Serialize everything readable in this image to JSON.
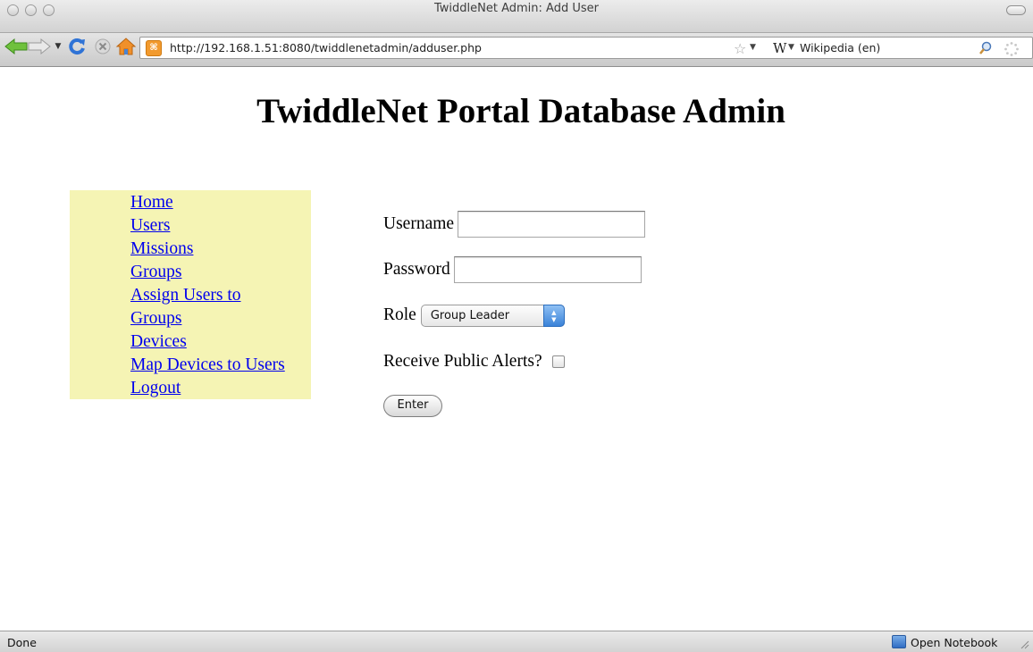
{
  "window": {
    "title": "TwiddleNet Admin: Add User"
  },
  "toolbar": {
    "url": "http://192.168.1.51:8080/twiddlenetadmin/adduser.php",
    "search_engine": "Wikipedia (en)",
    "icons": [
      "back-icon",
      "forward-icon",
      "history-dropdown-icon",
      "reload-icon",
      "stop-icon",
      "home-icon",
      "favicon",
      "bookmark-star-icon",
      "search-engine-icon",
      "search-go-icon",
      "throbber-icon"
    ]
  },
  "page": {
    "heading": "TwiddleNet Portal Database Admin",
    "nav": [
      {
        "label": "Home"
      },
      {
        "label": "Users"
      },
      {
        "label": "Missions"
      },
      {
        "label": "Groups"
      },
      {
        "label": "Assign Users to Groups"
      },
      {
        "label": "Devices"
      },
      {
        "label": "Map Devices to Users"
      },
      {
        "label": "Logout"
      }
    ],
    "form": {
      "username_label": "Username",
      "username_value": "",
      "password_label": "Password",
      "password_value": "",
      "role_label": "Role",
      "role_selected": "Group Leader",
      "alerts_label": "Receive Public Alerts?",
      "alerts_checked": false,
      "submit_label": "Enter"
    }
  },
  "statusbar": {
    "status": "Done",
    "notebook_label": "Open Notebook"
  },
  "colors": {
    "nav_background": "#f5f4b4",
    "link": "#0000ee",
    "select_arrow_accent": "#3a82d8"
  }
}
